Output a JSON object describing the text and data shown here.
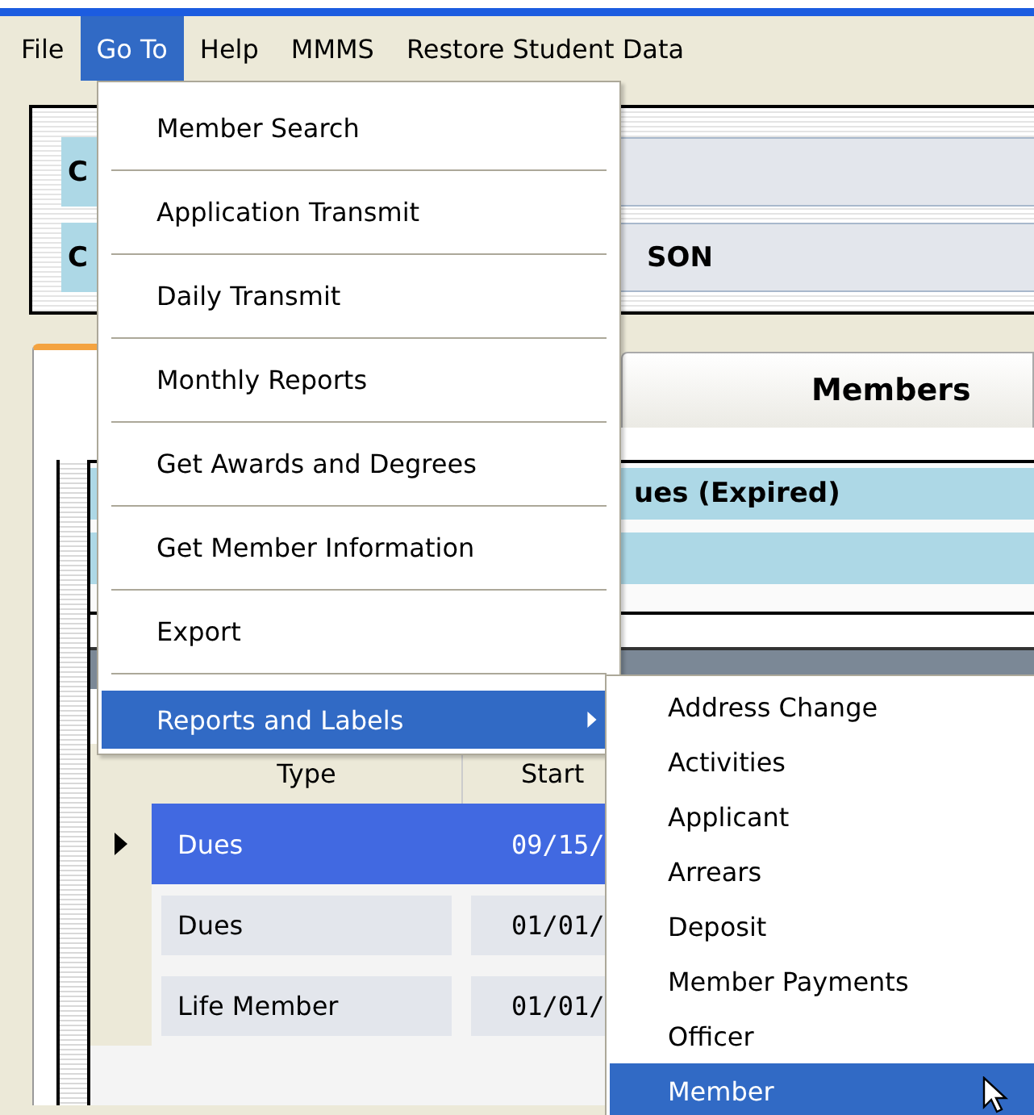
{
  "menu_bar": [
    {
      "label": "File",
      "selected": false
    },
    {
      "label": "Go To",
      "selected": true
    },
    {
      "label": "Help",
      "selected": false
    },
    {
      "label": "MMMS",
      "selected": false
    },
    {
      "label": "Restore Student Data",
      "selected": false
    }
  ],
  "header_panel": {
    "fields": [
      {
        "label": "C"
      },
      {
        "label": "C",
        "value": "SON"
      }
    ]
  },
  "tabs": [
    {
      "label": "Members",
      "selected": false
    }
  ],
  "status_rows": [
    {
      "text": "ues (Expired)"
    },
    {}
  ],
  "grid": {
    "columns": [
      "Type",
      "Start"
    ],
    "rows": [
      {
        "type": "Dues",
        "start": "09/15/",
        "selected": true
      },
      {
        "type": "Dues",
        "start": "01/01/",
        "selected": false
      },
      {
        "type": "Life Member",
        "start": "01/01/",
        "selected": false
      }
    ]
  },
  "go_to_menu": [
    {
      "label": "Member Search",
      "selected": false,
      "has_submenu": false
    },
    {
      "label": "Application Transmit",
      "selected": false,
      "has_submenu": false
    },
    {
      "label": "Daily Transmit",
      "selected": false,
      "has_submenu": false
    },
    {
      "label": "Monthly Reports",
      "selected": false,
      "has_submenu": false
    },
    {
      "label": "Get Awards and Degrees",
      "selected": false,
      "has_submenu": false
    },
    {
      "label": "Get Member Information",
      "selected": false,
      "has_submenu": false
    },
    {
      "label": "Export",
      "selected": false,
      "has_submenu": false
    },
    {
      "label": "Reports and Labels",
      "selected": true,
      "has_submenu": true
    }
  ],
  "submenu": [
    {
      "label": "Address Change",
      "selected": false
    },
    {
      "label": "Activities",
      "selected": false
    },
    {
      "label": "Applicant",
      "selected": false
    },
    {
      "label": "Arrears",
      "selected": false
    },
    {
      "label": "Deposit",
      "selected": false
    },
    {
      "label": "Member Payments",
      "selected": false
    },
    {
      "label": "Officer",
      "selected": false
    },
    {
      "label": "Member",
      "selected": true
    }
  ]
}
